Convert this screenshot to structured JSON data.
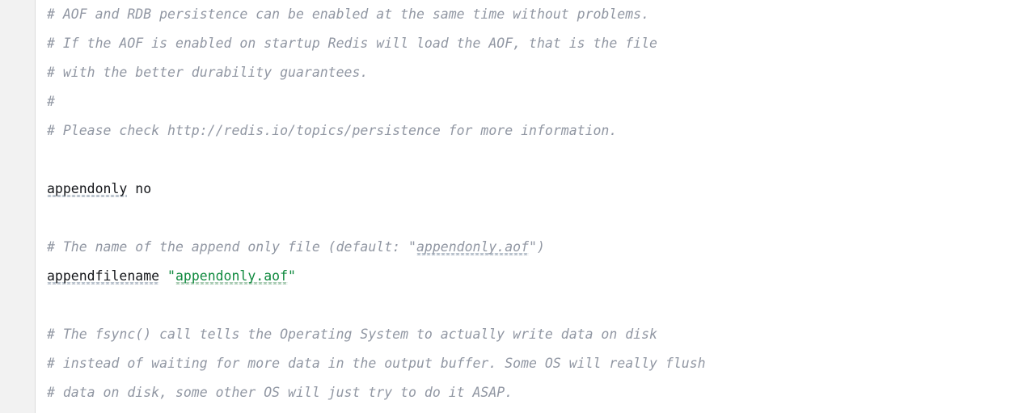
{
  "editor": {
    "file_kind": "redis-config",
    "gutter": {
      "background_color": "#f2f2f2",
      "border_color": "#dcdcdc"
    },
    "colors": {
      "background": "#ffffff",
      "comment": "#9197a3",
      "plain_text": "#14161a",
      "string": "#108a3f",
      "spellcheck_squiggle": "#b9c2cc",
      "spellcheck_squiggle_string": "#a9cbb3"
    },
    "lines": [
      {
        "index": 0,
        "kind": "comment",
        "text": "# AOF and RDB persistence can be enabled at the same time without problems.",
        "segments": [
          {
            "style": "comment",
            "text": "# AOF and RDB persistence can be enabled at the same time without problems.",
            "squiggle": false
          }
        ]
      },
      {
        "index": 1,
        "kind": "comment",
        "text": "# If the AOF is enabled on startup Redis will load the AOF, that is the file",
        "segments": [
          {
            "style": "comment",
            "text": "# If the AOF is enabled on startup Redis will load the AOF, that is the file",
            "squiggle": false
          }
        ]
      },
      {
        "index": 2,
        "kind": "comment",
        "text": "# with the better durability guarantees.",
        "segments": [
          {
            "style": "comment",
            "text": "# with the better durability guarantees.",
            "squiggle": false
          }
        ]
      },
      {
        "index": 3,
        "kind": "comment",
        "text": "#",
        "segments": [
          {
            "style": "comment",
            "text": "#",
            "squiggle": false
          }
        ]
      },
      {
        "index": 4,
        "kind": "comment",
        "text": "# Please check http://redis.io/topics/persistence for more information.",
        "segments": [
          {
            "style": "comment",
            "text": "# Please check http://redis.io/topics/persistence for more information.",
            "squiggle": false
          }
        ]
      },
      {
        "index": 5,
        "kind": "blank",
        "text": "",
        "segments": []
      },
      {
        "index": 6,
        "kind": "directive",
        "text": "appendonly no",
        "segments": [
          {
            "style": "plain",
            "text": "appendonly",
            "squiggle": true
          },
          {
            "style": "plain",
            "text": " no",
            "squiggle": false
          }
        ]
      },
      {
        "index": 7,
        "kind": "blank",
        "text": "",
        "segments": []
      },
      {
        "index": 8,
        "kind": "comment",
        "text": "# The name of the append only file (default: \"appendonly.aof\")",
        "segments": [
          {
            "style": "comment",
            "text": "# The name of the append only file (default: \"",
            "squiggle": false
          },
          {
            "style": "comment",
            "text": "appendonly.aof",
            "squiggle": true
          },
          {
            "style": "comment",
            "text": "\")",
            "squiggle": false
          }
        ]
      },
      {
        "index": 9,
        "kind": "directive",
        "text": "appendfilename \"appendonly.aof\"",
        "segments": [
          {
            "style": "plain",
            "text": "appendfilename",
            "squiggle": true
          },
          {
            "style": "plain",
            "text": " ",
            "squiggle": false
          },
          {
            "style": "string",
            "text": "\"",
            "squiggle": false
          },
          {
            "style": "string",
            "text": "appendonly.aof",
            "squiggle": "green"
          },
          {
            "style": "string",
            "text": "\"",
            "squiggle": false
          }
        ]
      },
      {
        "index": 10,
        "kind": "blank",
        "text": "",
        "segments": []
      },
      {
        "index": 11,
        "kind": "comment",
        "text": "# The fsync() call tells the Operating System to actually write data on disk",
        "segments": [
          {
            "style": "comment",
            "text": "# The fsync() call tells the Operating System to actually write data on disk",
            "squiggle": false
          }
        ]
      },
      {
        "index": 12,
        "kind": "comment",
        "text": "# instead of waiting for more data in the output buffer. Some OS will really flush",
        "segments": [
          {
            "style": "comment",
            "text": "# instead of waiting for more data in the output buffer. Some OS will really flush",
            "squiggle": false
          }
        ]
      },
      {
        "index": 13,
        "kind": "comment",
        "text": "# data on disk, some other OS will just try to do it ASAP.",
        "segments": [
          {
            "style": "comment",
            "text": "# data on disk, some other OS will just try to do it ASAP.",
            "squiggle": false
          }
        ]
      }
    ]
  }
}
